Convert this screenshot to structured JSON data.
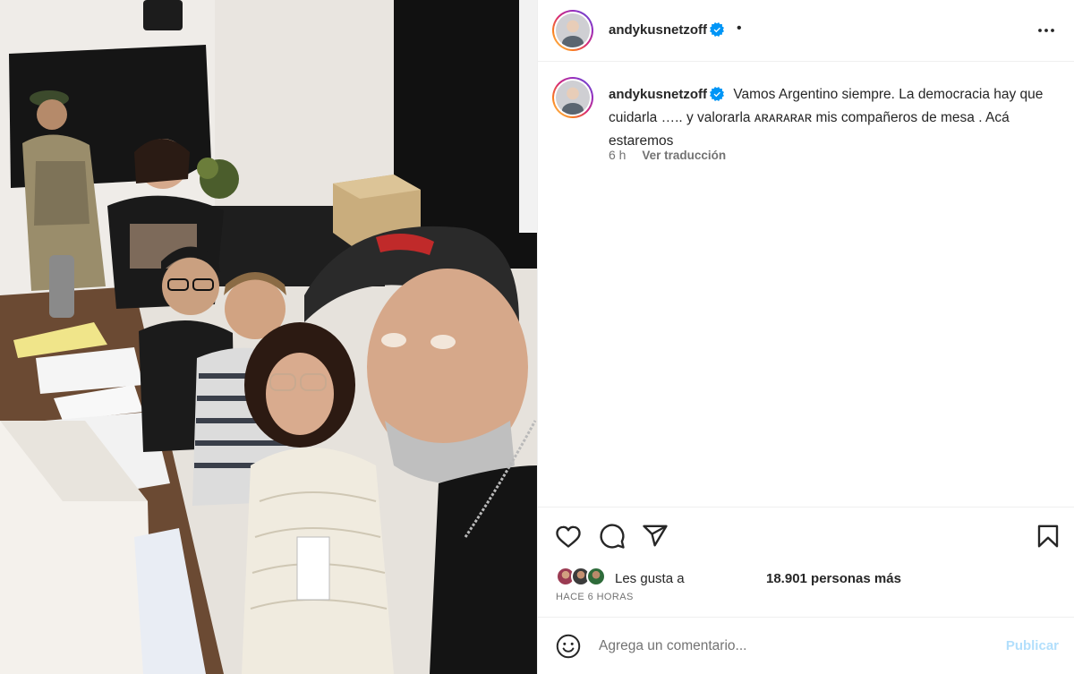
{
  "post": {
    "username": "andykusnetzoff",
    "separator": "•",
    "caption": "Vamos Argentino siempre. La democracia hay que cuidarla ….. y valorarla ᴀʀᴀʀᴀʀᴀʀ mis compañeros de mesa . Acá estaremos",
    "time_ago": "6 h",
    "translate_label": "Ver traducción"
  },
  "likes": {
    "label": "Les gusta a",
    "count_text": "18.901 personas más",
    "timestamp": "HACE 6 HORAS"
  },
  "comment": {
    "placeholder": "Agrega un comentario...",
    "publish_label": "Publicar"
  },
  "colors": {
    "accent": "#0095f6",
    "publish_disabled": "#b2dffc",
    "verified": "#0095f6",
    "secondary_text": "#737373"
  },
  "icons": [
    "verified-icon",
    "more-options-icon",
    "heart-icon",
    "comment-icon",
    "share-icon",
    "bookmark-icon",
    "emoji-icon"
  ]
}
